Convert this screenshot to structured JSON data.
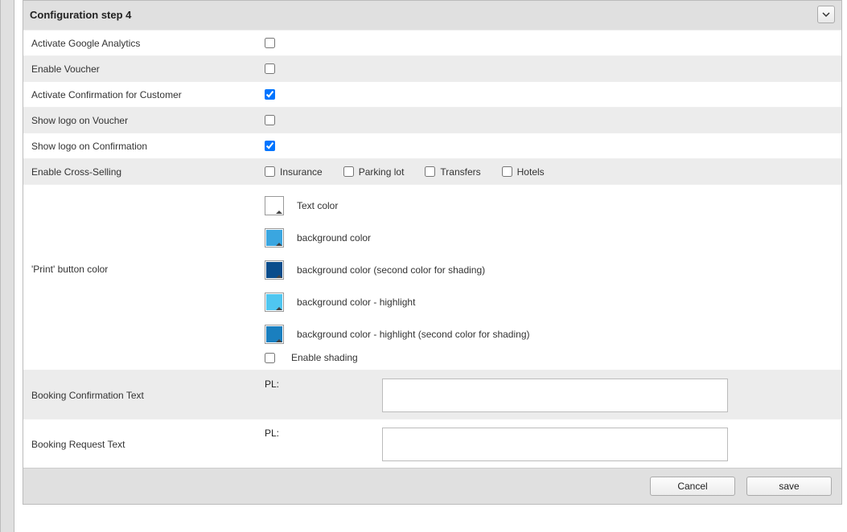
{
  "header": {
    "title": "Configuration step 4"
  },
  "rows": {
    "activate_analytics": {
      "label": "Activate Google Analytics",
      "checked": false
    },
    "enable_voucher": {
      "label": "Enable Voucher",
      "checked": false
    },
    "activate_confirmation": {
      "label": "Activate Confirmation for Customer",
      "checked": true
    },
    "show_logo_voucher": {
      "label": "Show logo on Voucher",
      "checked": false
    },
    "show_logo_confirmation": {
      "label": "Show logo on Confirmation",
      "checked": true
    },
    "cross_selling": {
      "label": "Enable Cross-Selling",
      "options": [
        {
          "label": "Insurance",
          "checked": false
        },
        {
          "label": "Parking lot",
          "checked": false
        },
        {
          "label": "Transfers",
          "checked": false
        },
        {
          "label": "Hotels",
          "checked": false
        }
      ]
    },
    "print_button": {
      "label": "'Print' button color",
      "colors": [
        {
          "label": "Text color",
          "hex": "#ffffff"
        },
        {
          "label": "background color",
          "hex": "#3aa6e0"
        },
        {
          "label": "background color (second color for shading)",
          "hex": "#0a4d8c"
        },
        {
          "label": "background color - highlight",
          "hex": "#4fc6f0"
        },
        {
          "label": "background color - highlight (second color for shading)",
          "hex": "#1a7fbf"
        }
      ],
      "enable_shading": {
        "label": "Enable shading",
        "checked": false
      }
    },
    "booking_confirmation": {
      "label": "Booking Confirmation Text",
      "lang_label": "PL:",
      "value": ""
    },
    "booking_request": {
      "label": "Booking Request Text",
      "lang_label": "PL:",
      "value": ""
    }
  },
  "footer": {
    "cancel": "Cancel",
    "save": "save"
  }
}
